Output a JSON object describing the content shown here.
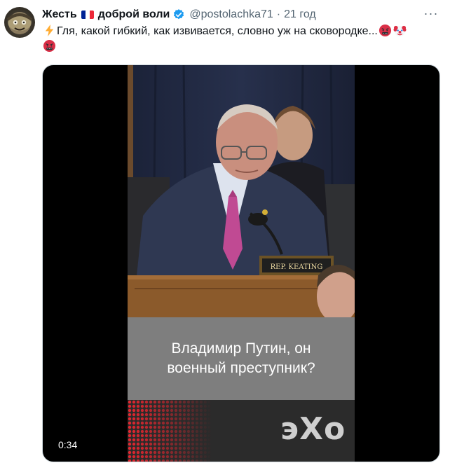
{
  "tweet": {
    "display_name_part1": "Жесть",
    "display_name_part2": "доброй воли",
    "handle": "@postolachka71",
    "separator": "·",
    "timestamp": "21 год",
    "more_label": "···",
    "text": "Гля, какой гибкий, как извивается, словно уж на сковородке...",
    "emoji": [
      "zap-emoji",
      "angry-face-with-symbols-emoji",
      "clown-face-emoji",
      "angry-face-with-symbols-emoji"
    ],
    "flag_icon": "france-flag-icon",
    "verified_icon": "verified-badge-icon",
    "colors": {
      "text": "#0f1419",
      "secondary": "#536471",
      "verified": "#1d9bf0",
      "border": "#cfd9de"
    }
  },
  "media": {
    "type": "video",
    "caption_line1": "Владимир Путин, он",
    "caption_line2": "военный преступник?",
    "nameplate": "REP. KEATING",
    "brand_logo": "эХо",
    "duration": "0:34"
  }
}
